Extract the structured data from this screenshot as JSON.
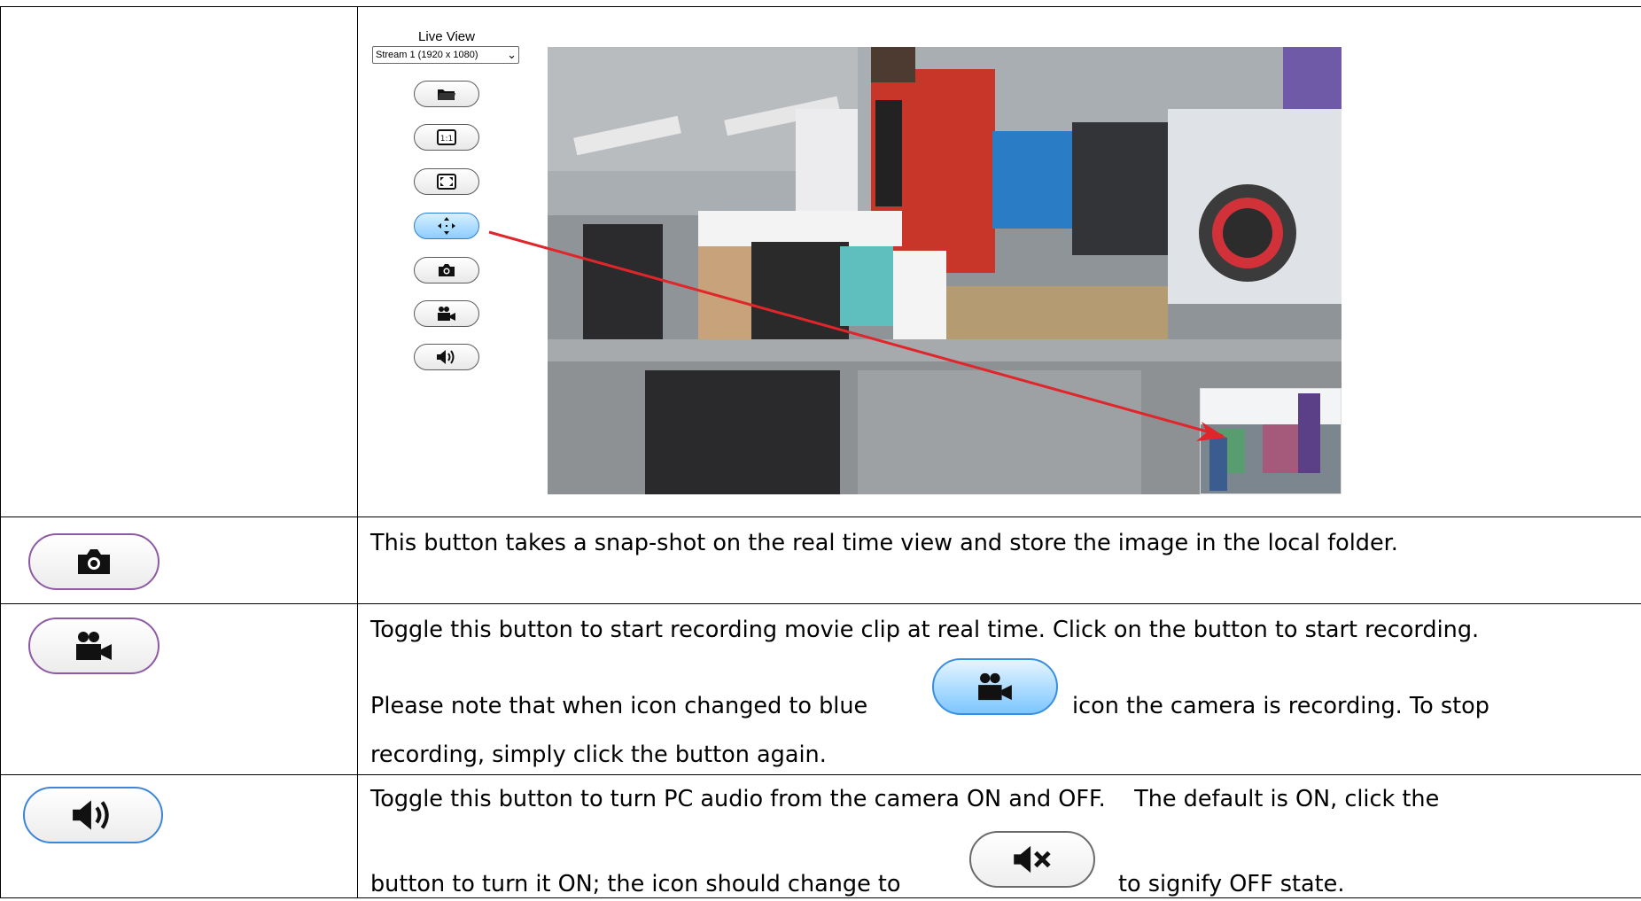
{
  "live_view": {
    "title": "Live View",
    "stream_select": "Stream 1 (1920 x 1080)",
    "buttons": [
      {
        "name": "folder-button",
        "icon": "folder-icon"
      },
      {
        "name": "one-to-one-button",
        "icon": "one-to-one-icon",
        "label": "1:1"
      },
      {
        "name": "fit-screen-button",
        "icon": "fit-screen-icon"
      },
      {
        "name": "pan-button",
        "icon": "move-arrows-icon",
        "active": true
      },
      {
        "name": "snapshot-button",
        "icon": "camera-icon"
      },
      {
        "name": "record-button",
        "icon": "video-camera-icon"
      },
      {
        "name": "audio-button",
        "icon": "speaker-icon"
      }
    ]
  },
  "rows": {
    "snapshot": {
      "icon": "camera-icon",
      "text": "This button takes a snap-shot on the real time view and store the image in the local folder."
    },
    "record": {
      "icon": "video-camera-icon",
      "line1": "Toggle this button to start recording movie clip at real time. Click on the button to start recording.",
      "line2_before": "Please note that when icon changed to blue",
      "line2_after": "icon the camera is recording. To stop",
      "line3": "recording, simply click the button again."
    },
    "audio": {
      "icon": "speaker-icon",
      "line1": "Toggle this button to turn PC audio from the camera ON and OFF.    The default is ON, click the",
      "line2_before": "button to turn it ON; the icon should change to",
      "line2_after": "to signify OFF state.",
      "mute_icon": "mute-icon"
    }
  },
  "colors": {
    "arrow": "#e0262b",
    "active_button": "#8ccdff",
    "button_border": "#8e5aa5"
  }
}
